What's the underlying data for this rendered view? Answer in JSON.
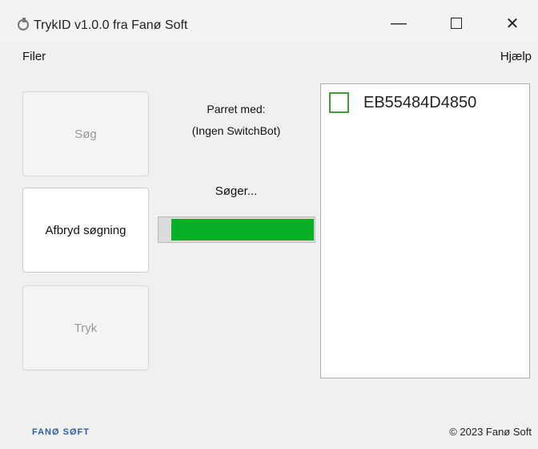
{
  "window": {
    "title": "TrykID v1.0.0 fra Fanø Soft",
    "controls": {
      "minimize_icon": "minimize-icon",
      "maximize_icon": "maximize-icon",
      "close_icon": "close-icon",
      "minimize": "—",
      "close": "✕"
    }
  },
  "menu": {
    "left": "Filer",
    "right": "Hjælp"
  },
  "actions": {
    "search": "Søg",
    "stop_search": "Afbryd søgning",
    "press": "Tryk"
  },
  "status": {
    "paired_label": "Parret med:",
    "paired_value": "(Ingen SwitchBot)",
    "searching": "Søger...",
    "progress_fraction": 0.92,
    "progress_color": "#06b025"
  },
  "devices": [
    {
      "id": "EB55484D4850",
      "checked": false
    }
  ],
  "footer": {
    "logo": "FANØ SØFT",
    "copyright": "© 2023 Fanø Soft"
  }
}
